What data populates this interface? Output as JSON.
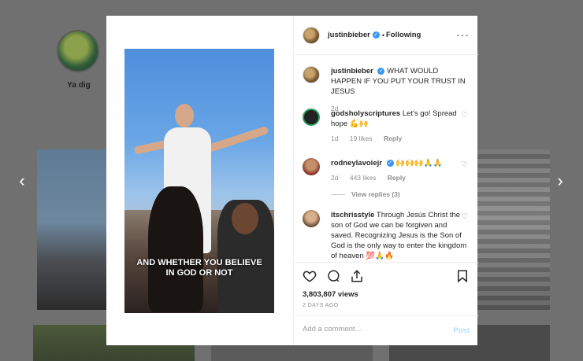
{
  "background": {
    "profile_name": "Ya dig"
  },
  "header": {
    "username": "justinbieber",
    "verified_mark": "✓",
    "separator": "•",
    "following_label": "Following",
    "more_label": "···"
  },
  "caption_comment": {
    "username": "justinbieber",
    "text": "WHAT WOULD HAPPEN IF YOU PUT YOUR TRUST IN JESUS",
    "time": "2d"
  },
  "comments": [
    {
      "username": "godsholyscriptures",
      "text": "Let's go! Spread hope 💪🙌",
      "time": "1d",
      "likes": "19 likes",
      "reply_label": "Reply"
    },
    {
      "username": "rodneylavoiejr",
      "text": "🙌🙌🙌🙏🙏",
      "time": "2d",
      "likes": "443 likes",
      "reply_label": "Reply",
      "view_replies": "View replies (3)"
    },
    {
      "username": "itschrisstyle",
      "text": "Through Jesús Christ the son of God we can be forgiven and saved. Recognizing Jesus is the Son of God is the only way to enter the kingdom of heaven 💯🙏🔥"
    }
  ],
  "video": {
    "caption_line1": "AND WHETHER YOU BELIEVE",
    "caption_line2": "IN GOD OR NOT"
  },
  "actions": {
    "views": "3,803,807 views",
    "date": "2 DAYS AGO"
  },
  "add_comment": {
    "placeholder": "Add a comment...",
    "post_label": "Post"
  },
  "nav": {
    "prev": "‹",
    "next": "›"
  },
  "colors": {
    "verified": "#3897f0",
    "post_disabled": "#b2dffc",
    "meta_gray": "#8e8e8e"
  }
}
